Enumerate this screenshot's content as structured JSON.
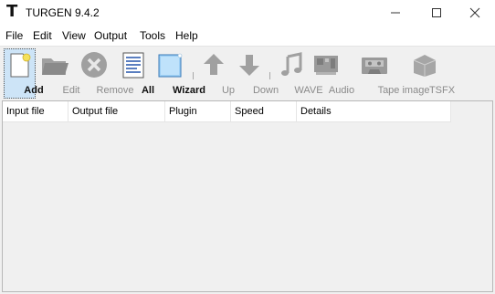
{
  "window": {
    "logo": "T",
    "title": "TURGEN 9.4.2"
  },
  "menu": [
    "File",
    "Edit",
    "View",
    "Output",
    "Tools",
    "Help"
  ],
  "toolbar": {
    "add": "Add",
    "edit": "Edit",
    "remove": "Remove",
    "all": "All",
    "wizard": "Wizard",
    "up": "Up",
    "down": "Down",
    "wave": "WAVE",
    "audio": "Audio",
    "tape_image": "Tape image",
    "tsfx": "TSFX"
  },
  "columns": [
    "Input file",
    "Output file",
    "Plugin",
    "Speed",
    "Details"
  ],
  "colors": {
    "toolbar_bg": "#f0f0f0",
    "disabled_icon": "#9a9a9a",
    "selected_bg": "#cde4f7"
  }
}
